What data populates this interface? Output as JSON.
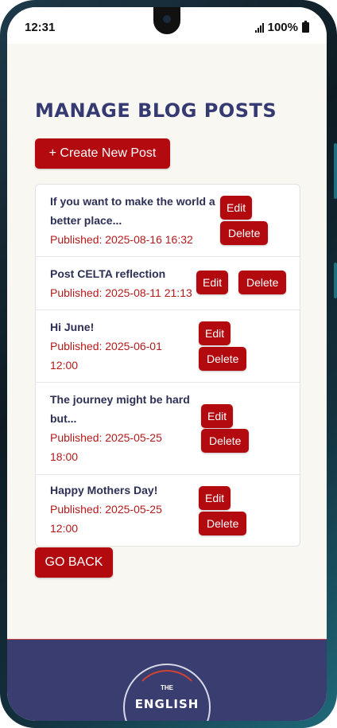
{
  "status_bar": {
    "time": "12:31",
    "battery": "100%"
  },
  "page": {
    "title": "MANAGE BLOG POSTS",
    "create_label": "+ Create New Post",
    "goback_label": "GO BACK"
  },
  "posts": [
    {
      "title": "If you want to make the world a better place...",
      "title_lines": [
        "If you want to make the world a",
        "better place..."
      ],
      "date": "Published: 2025-08-16 16:32",
      "date_lines": [
        "Published: 2025-08-16 16:32"
      ],
      "edit": "Edit",
      "delete": "Delete"
    },
    {
      "title": "Post CELTA reflection",
      "title_lines": [
        "Post CELTA reflection"
      ],
      "date": "Published: 2025-08-11 21:13",
      "date_lines": [
        "Published: 2025-08-11 21:13"
      ],
      "edit": "Edit",
      "delete": "Delete"
    },
    {
      "title": "Hi June!",
      "title_lines": [
        "Hi June!"
      ],
      "date": "Published: 2025-06-01 12:00",
      "date_lines": [
        "Published: 2025-06-01",
        "12:00"
      ],
      "edit": "Edit",
      "delete": "Delete"
    },
    {
      "title": "The journey might be hard but...",
      "title_lines": [
        "The journey might be hard",
        "but..."
      ],
      "date": "Published: 2025-05-25 18:00",
      "date_lines": [
        "Published: 2025-05-25",
        "18:00"
      ],
      "edit": "Edit",
      "delete": "Delete"
    },
    {
      "title": "Happy Mothers Day!",
      "title_lines": [
        "Happy Mothers Day!"
      ],
      "date": "Published: 2025-05-25 12:00",
      "date_lines": [
        "Published: 2025-05-25",
        "12:00"
      ],
      "edit": "Edit",
      "delete": "Delete"
    }
  ],
  "footer": {
    "logo_top": "THE",
    "logo_main": "ENGLISH"
  },
  "colors": {
    "title": "#353a72",
    "button": "#b20a0f",
    "date": "#b41a1a",
    "footer": "#3a3d70"
  },
  "icons": [
    "signal-icon",
    "battery-icon"
  ]
}
